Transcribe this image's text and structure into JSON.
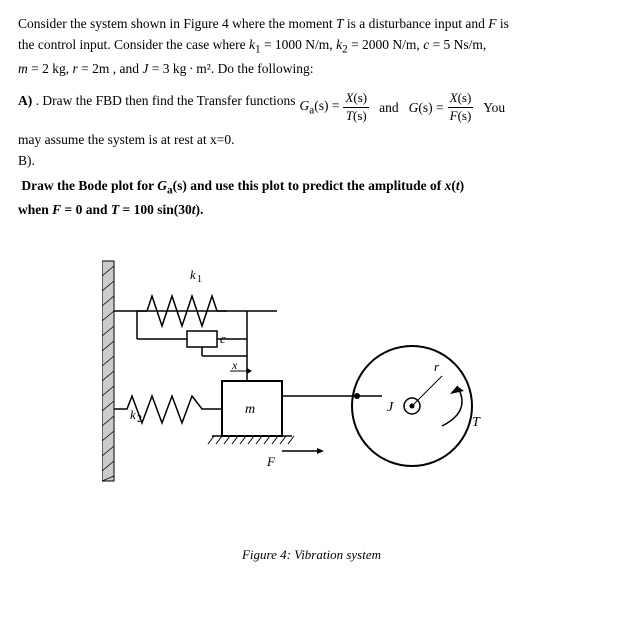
{
  "intro": {
    "line1": "Consider the system shown in Figure 4 where the moment T is a disturbance input and F is",
    "line2": "the control input. Consider the case where k",
    "line2_sub1": "1",
    "line2_eq": " = 1000 N/m, k",
    "line2_sub2": "2",
    "line2_eq2": " = 2000 N/m, c = 5 Ns/m,",
    "line3": "m = 2 kg, r = 2m , and J = 3 kg⋅m². Do the following:"
  },
  "sectionA": {
    "label": "A)",
    "text1": " . Draw the FBD then find the Transfer functions",
    "ga_label": "G",
    "ga_sub": "a",
    "ga_s": "(s) =",
    "numer": "X(s)",
    "denom_t": "T(s)",
    "and_label": "and",
    "g_label": "G(s) =",
    "numer2": "X(s)",
    "denom_f": "F(s)",
    "you_text": "You",
    "line2": "may assume the system is at rest at x=0.",
    "b_label": "B)."
  },
  "sectionB": {
    "text": "Draw the Bode plot for G",
    "sub": "a",
    "text2": "(s) and use this plot to predict the amplitude of x(t)",
    "text3": "when F = 0 and T = 100 sin(30t)."
  },
  "figure": {
    "caption": "Figure 4: Vibration system",
    "k1_label": "k₁",
    "k2_label": "k₂",
    "m_label": "m",
    "c_label": "c",
    "x_label": "x",
    "j_label": "J",
    "r_label": "r",
    "t_label": "T",
    "f_label": "F"
  }
}
